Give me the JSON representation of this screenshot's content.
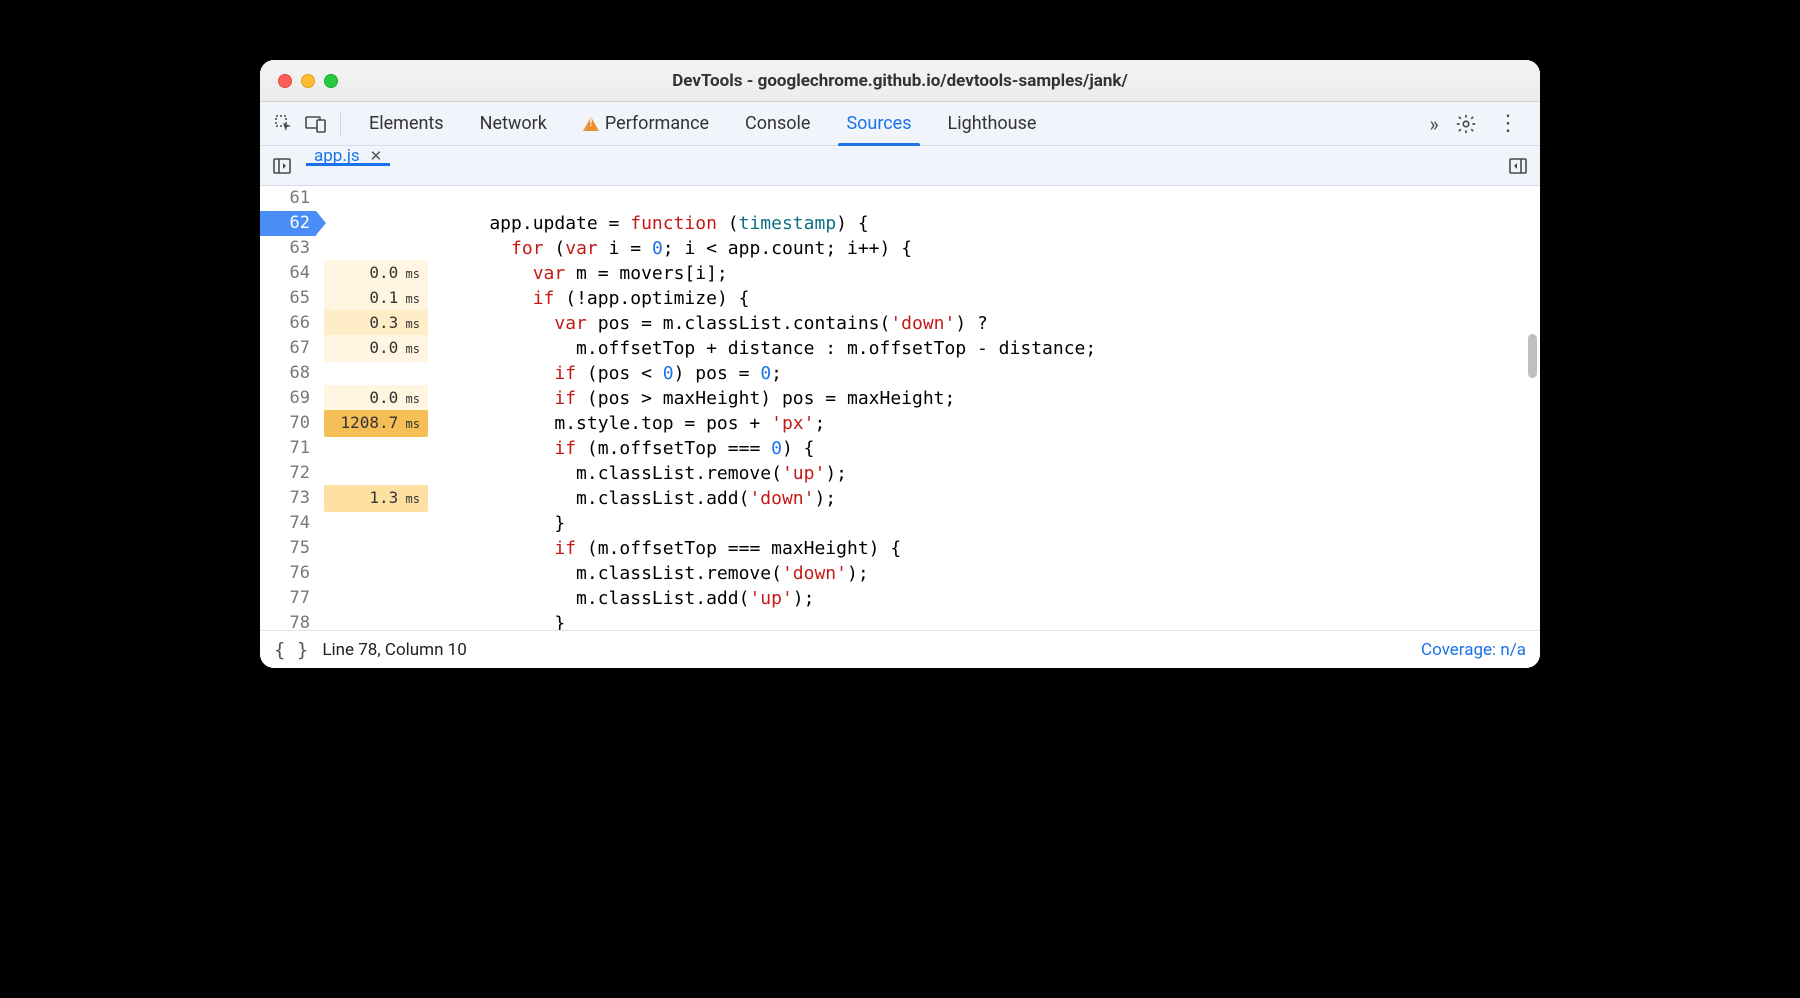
{
  "window": {
    "title": "DevTools - googlechrome.github.io/devtools-samples/jank/"
  },
  "toolbar": {
    "tabs": [
      {
        "label": "Elements",
        "active": false,
        "warn": false
      },
      {
        "label": "Network",
        "active": false,
        "warn": false
      },
      {
        "label": "Performance",
        "active": false,
        "warn": true
      },
      {
        "label": "Console",
        "active": false,
        "warn": false
      },
      {
        "label": "Sources",
        "active": true,
        "warn": false
      },
      {
        "label": "Lighthouse",
        "active": false,
        "warn": false
      }
    ]
  },
  "filetabs": {
    "items": [
      {
        "label": "app.js",
        "active": true
      }
    ]
  },
  "editor": {
    "lines": [
      {
        "n": 61,
        "timing": "",
        "heat": 0,
        "bp": false,
        "tokens": []
      },
      {
        "n": 62,
        "timing": "",
        "heat": 0,
        "bp": true,
        "tokens": [
          [
            "",
            "    app.update = "
          ],
          [
            "red",
            "function"
          ],
          [
            "",
            " ("
          ],
          [
            "teal",
            "timestamp"
          ],
          [
            "",
            ") {"
          ]
        ]
      },
      {
        "n": 63,
        "timing": "",
        "heat": 0,
        "bp": false,
        "tokens": [
          [
            "",
            "      "
          ],
          [
            "red",
            "for"
          ],
          [
            "",
            " ("
          ],
          [
            "red",
            "var"
          ],
          [
            "",
            " i = "
          ],
          [
            "num",
            "0"
          ],
          [
            "",
            "; i < app.count; i++) {"
          ]
        ]
      },
      {
        "n": 64,
        "timing": "0.0",
        "heat": 1,
        "bp": false,
        "tokens": [
          [
            "",
            "        "
          ],
          [
            "red",
            "var"
          ],
          [
            "",
            " m = movers[i];"
          ]
        ]
      },
      {
        "n": 65,
        "timing": "0.1",
        "heat": 1,
        "bp": false,
        "tokens": [
          [
            "",
            "        "
          ],
          [
            "red",
            "if"
          ],
          [
            "",
            " (!app.optimize) {"
          ]
        ]
      },
      {
        "n": 66,
        "timing": "0.3",
        "heat": 2,
        "bp": false,
        "tokens": [
          [
            "",
            "          "
          ],
          [
            "red",
            "var"
          ],
          [
            "",
            " pos = m.classList.contains("
          ],
          [
            "red",
            "'down'"
          ],
          [
            "",
            ") ?"
          ]
        ]
      },
      {
        "n": 67,
        "timing": "0.0",
        "heat": 1,
        "bp": false,
        "tokens": [
          [
            "",
            "            m.offsetTop + distance : m.offsetTop - distance;"
          ]
        ]
      },
      {
        "n": 68,
        "timing": "",
        "heat": 0,
        "bp": false,
        "tokens": [
          [
            "",
            "          "
          ],
          [
            "red",
            "if"
          ],
          [
            "",
            " (pos < "
          ],
          [
            "num",
            "0"
          ],
          [
            "",
            ") pos = "
          ],
          [
            "num",
            "0"
          ],
          [
            "",
            ";"
          ]
        ]
      },
      {
        "n": 69,
        "timing": "0.0",
        "heat": 1,
        "bp": false,
        "tokens": [
          [
            "",
            "          "
          ],
          [
            "red",
            "if"
          ],
          [
            "",
            " (pos > maxHeight) pos = maxHeight;"
          ]
        ]
      },
      {
        "n": 70,
        "timing": "1208.7",
        "heat": 5,
        "bp": false,
        "tokens": [
          [
            "",
            "          m.style.top = pos + "
          ],
          [
            "red",
            "'px'"
          ],
          [
            "",
            ";"
          ]
        ]
      },
      {
        "n": 71,
        "timing": "",
        "heat": 0,
        "bp": false,
        "tokens": [
          [
            "",
            "          "
          ],
          [
            "red",
            "if"
          ],
          [
            "",
            " (m.offsetTop === "
          ],
          [
            "num",
            "0"
          ],
          [
            "",
            ") {"
          ]
        ]
      },
      {
        "n": 72,
        "timing": "",
        "heat": 0,
        "bp": false,
        "tokens": [
          [
            "",
            "            m.classList.remove("
          ],
          [
            "red",
            "'up'"
          ],
          [
            "",
            ");"
          ]
        ]
      },
      {
        "n": 73,
        "timing": "1.3",
        "heat": 3,
        "bp": false,
        "tokens": [
          [
            "",
            "            m.classList.add("
          ],
          [
            "red",
            "'down'"
          ],
          [
            "",
            ");"
          ]
        ]
      },
      {
        "n": 74,
        "timing": "",
        "heat": 0,
        "bp": false,
        "tokens": [
          [
            "",
            "          }"
          ]
        ]
      },
      {
        "n": 75,
        "timing": "",
        "heat": 0,
        "bp": false,
        "tokens": [
          [
            "",
            "          "
          ],
          [
            "red",
            "if"
          ],
          [
            "",
            " (m.offsetTop === maxHeight) {"
          ]
        ]
      },
      {
        "n": 76,
        "timing": "",
        "heat": 0,
        "bp": false,
        "tokens": [
          [
            "",
            "            m.classList.remove("
          ],
          [
            "red",
            "'down'"
          ],
          [
            "",
            ");"
          ]
        ]
      },
      {
        "n": 77,
        "timing": "",
        "heat": 0,
        "bp": false,
        "tokens": [
          [
            "",
            "            m.classList.add("
          ],
          [
            "red",
            "'up'"
          ],
          [
            "",
            ");"
          ]
        ]
      },
      {
        "n": 78,
        "timing": "",
        "heat": 0,
        "bp": false,
        "tokens": [
          [
            "",
            "          }"
          ]
        ]
      }
    ]
  },
  "statusbar": {
    "position": "Line 78, Column 10",
    "coverage": "Coverage: n/a"
  }
}
